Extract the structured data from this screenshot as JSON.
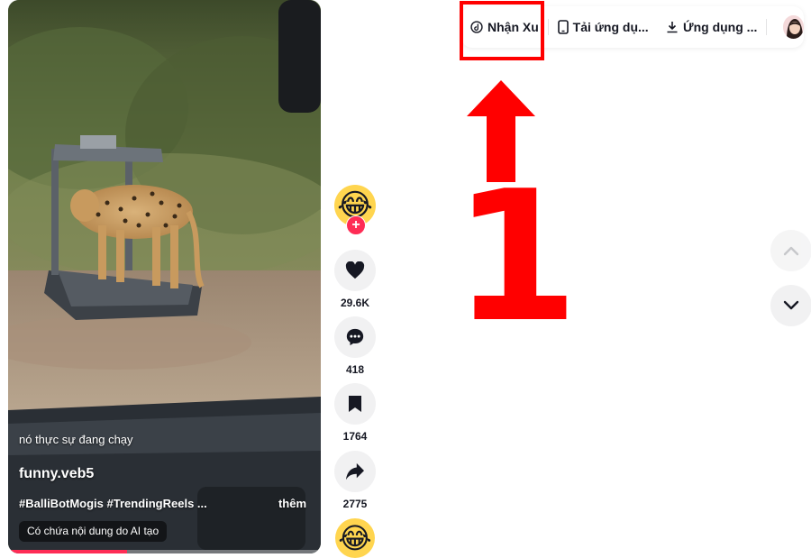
{
  "video": {
    "caption": "nó thực sự đang chạy",
    "author": "funny.veb5",
    "hashtags": "#BalliBotMogis #TrendingReels ...",
    "more_label": "thêm",
    "ai_label": "Có chứa nội dung do AI tạo",
    "progress_fraction": 0.38
  },
  "actions": {
    "avatar_emoji": "😂",
    "follow_symbol": "+",
    "likes": "29.6K",
    "comments": "418",
    "saves": "1764",
    "shares": "2775",
    "next_avatar_emoji": "😂"
  },
  "topbar": {
    "coins_label": "Nhận Xu",
    "get_app_label": "Tải ứng dụ...",
    "desktop_app_label": "Ứng dụng ..."
  },
  "annotation": {
    "step_number": "1",
    "color": "#ff0000"
  },
  "colors": {
    "accent": "#fe2c55",
    "button_bg": "#f1f1f2"
  }
}
